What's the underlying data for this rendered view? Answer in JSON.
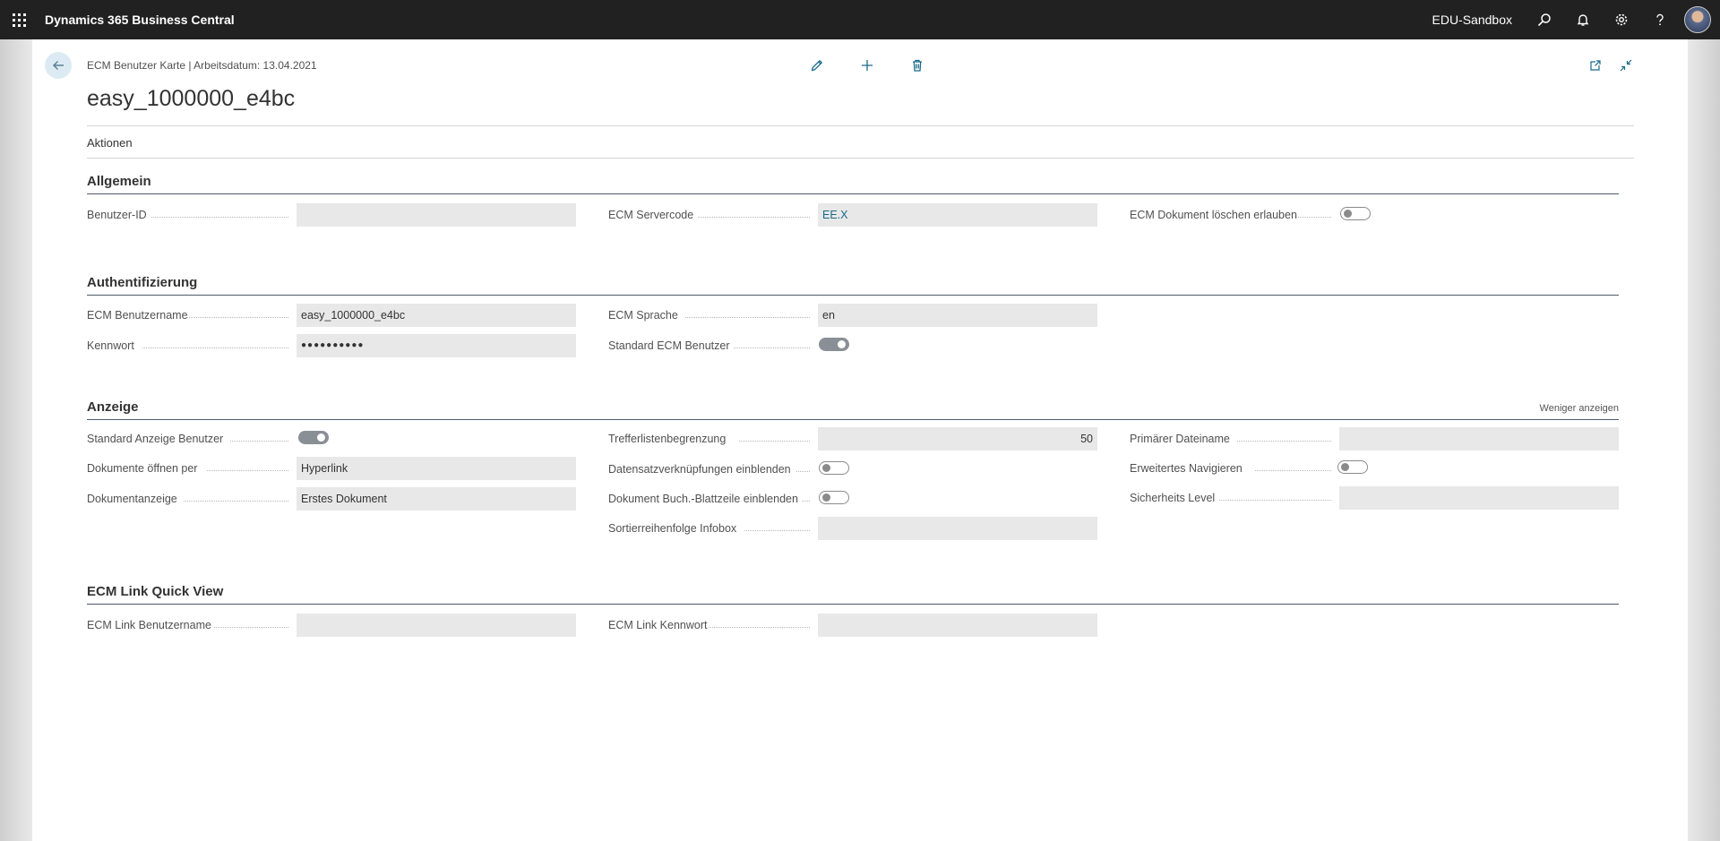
{
  "app": {
    "title": "Dynamics 365 Business Central",
    "environment": "EDU-Sandbox"
  },
  "icons": {
    "waffle": "app-launcher-icon",
    "search": "search-icon",
    "bell": "notification-bell-icon",
    "gear": "settings-gear-icon",
    "help": "help-question-icon",
    "back": "back-arrow-icon",
    "edit": "pencil-edit-icon",
    "new": "plus-new-icon",
    "delete": "trash-delete-icon",
    "open_new": "open-in-new-window-icon",
    "collapse": "collapse-arrows-icon"
  },
  "header": {
    "breadcrumb": "ECM Benutzer Karte | Arbeitsdatum: 13.04.2021",
    "record_title": "easy_1000000_e4bc",
    "menu": {
      "actions": "Aktionen"
    }
  },
  "sections": {
    "allgemein": {
      "title": "Allgemein",
      "benutzer_id": {
        "label": "Benutzer-ID",
        "value": ""
      },
      "ecm_servercode": {
        "label": "ECM Servercode",
        "value": "EE.X"
      },
      "ecm_dok_loeschen": {
        "label": "ECM Dokument löschen erlauben",
        "on": false
      }
    },
    "authentifizierung": {
      "title": "Authentifizierung",
      "ecm_benutzername": {
        "label": "ECM Benutzername",
        "value": "easy_1000000_e4bc"
      },
      "kennwort": {
        "label": "Kennwort",
        "value": "●●●●●●●●●●"
      },
      "ecm_sprache": {
        "label": "ECM Sprache",
        "value": "en"
      },
      "standard_ecm_benutzer": {
        "label": "Standard ECM Benutzer",
        "on": true
      }
    },
    "anzeige": {
      "title": "Anzeige",
      "show_less": "Weniger anzeigen",
      "standard_anzeige_benutzer": {
        "label": "Standard Anzeige Benutzer",
        "on": true
      },
      "dokumente_oeffnen_per": {
        "label": "Dokumente öffnen per",
        "value": "Hyperlink"
      },
      "dokumentanzeige": {
        "label": "Dokumentanzeige",
        "value": "Erstes Dokument"
      },
      "trefferlistenbegrenzung": {
        "label": "Trefferlistenbegrenzung",
        "value": "50"
      },
      "datensatzverknuepfungen": {
        "label": "Datensatzverknüpfungen einblenden",
        "on": false
      },
      "dok_buch_blattzeile": {
        "label": "Dokument Buch.-Blattzeile einblenden",
        "on": false
      },
      "sortierreihenfolge": {
        "label": "Sortierreihenfolge Infobox",
        "value": ""
      },
      "primaerer_dateiname": {
        "label": "Primärer Dateiname",
        "value": ""
      },
      "erweitertes_navigieren": {
        "label": "Erweitertes Navigieren",
        "on": false
      },
      "sicherheits_level": {
        "label": "Sicherheits Level",
        "value": ""
      }
    },
    "quickview": {
      "title": "ECM Link Quick View",
      "link_benutzername": {
        "label": "ECM Link Benutzername",
        "value": ""
      },
      "link_kennwort": {
        "label": "ECM Link Kennwort",
        "value": ""
      }
    }
  },
  "colors": {
    "topbar": "#212121",
    "accent": "#1a6a8a",
    "field_bg": "#e8e8e8",
    "section_rule": "#4e5a6b"
  }
}
